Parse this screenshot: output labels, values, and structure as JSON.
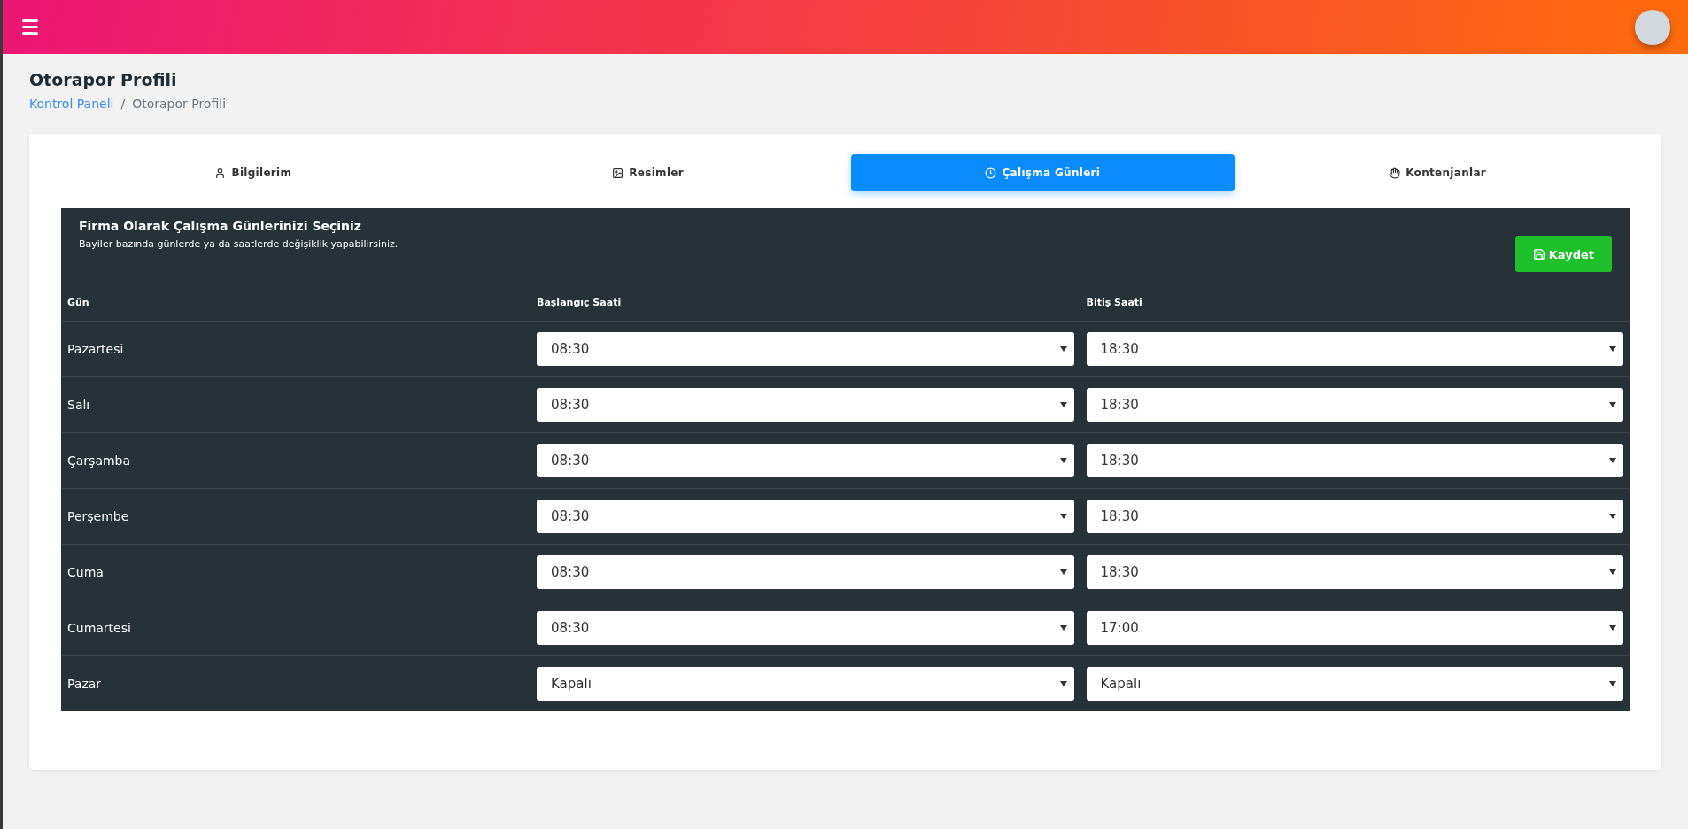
{
  "page": {
    "title": "Otorapor Profili"
  },
  "breadcrumb": [
    {
      "label": "Kontrol Paneli",
      "kind": "link"
    },
    {
      "label": "/",
      "kind": "separator"
    },
    {
      "label": "Otorapor Profili",
      "kind": "current"
    }
  ],
  "tabs": [
    {
      "label": "Bilgilerim",
      "kind": "user",
      "selected": false
    },
    {
      "label": "Resimler",
      "kind": "image",
      "selected": false
    },
    {
      "label": "Çalışma Günleri",
      "kind": "clock",
      "selected": true
    },
    {
      "label": "Kontenjanlar",
      "kind": "hand",
      "selected": false
    }
  ],
  "panel": {
    "title": "Firma Olarak Çalışma Günlerinizi Seçiniz",
    "subtitle": "Bayiler bazında günlerde ya da saatlerde değişiklik yapabilirsiniz.",
    "save_button": "Kaydet"
  },
  "table": {
    "columns": [
      "Gün",
      "Başlangıç Saati",
      "Bitiş Saati"
    ],
    "rows": [
      {
        "day": "Pazartesi",
        "start": "08:30",
        "end": "18:30"
      },
      {
        "day": "Salı",
        "start": "08:30",
        "end": "18:30"
      },
      {
        "day": "Çarşamba",
        "start": "08:30",
        "end": "18:30"
      },
      {
        "day": "Perşembe",
        "start": "08:30",
        "end": "18:30"
      },
      {
        "day": "Cuma",
        "start": "08:30",
        "end": "18:30"
      },
      {
        "day": "Cumartesi",
        "start": "08:30",
        "end": "17:00"
      },
      {
        "day": "Pazar",
        "start": "Kapalı",
        "end": "Kapalı"
      }
    ]
  }
}
